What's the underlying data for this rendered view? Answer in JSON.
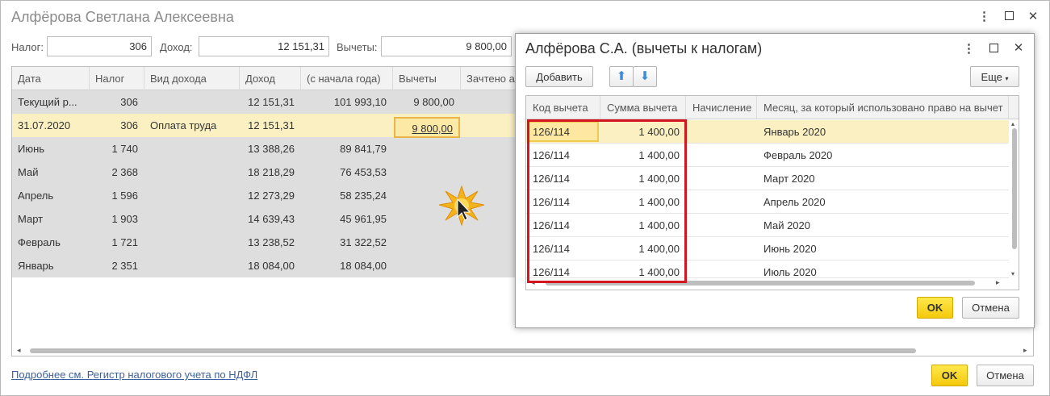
{
  "main": {
    "title": "Алфёрова Светлана Алексеевна",
    "tax_label": "Налог:",
    "tax_value": "306",
    "income_label": "Доход:",
    "income_value": "12 151,31",
    "deductions_label": "Вычеты:",
    "deductions_value": "9 800,00",
    "columns": [
      "Дата",
      "Налог",
      "Вид дохода",
      "Доход",
      "(с начала года)",
      "Вычеты",
      "Зачтено а"
    ],
    "rows": [
      {
        "date": "Текущий р...",
        "tax": "306",
        "type": "",
        "income": "12 151,31",
        "ytd": "101 993,10",
        "deductions": "9 800,00"
      },
      {
        "date": "31.07.2020",
        "tax": "306",
        "type": "Оплата труда",
        "income": "12 151,31",
        "ytd": "",
        "deductions": "9 800,00"
      },
      {
        "date": "Июнь",
        "tax": "1 740",
        "type": "",
        "income": "13 388,26",
        "ytd": "89 841,79",
        "deductions": ""
      },
      {
        "date": "Май",
        "tax": "2 368",
        "type": "",
        "income": "18 218,29",
        "ytd": "76 453,53",
        "deductions": ""
      },
      {
        "date": "Апрель",
        "tax": "1 596",
        "type": "",
        "income": "12 273,29",
        "ytd": "58 235,24",
        "deductions": ""
      },
      {
        "date": "Март",
        "tax": "1 903",
        "type": "",
        "income": "14 639,43",
        "ytd": "45 961,95",
        "deductions": ""
      },
      {
        "date": "Февраль",
        "tax": "1 721",
        "type": "",
        "income": "13 238,52",
        "ytd": "31 322,52",
        "deductions": ""
      },
      {
        "date": "Январь",
        "tax": "2 351",
        "type": "",
        "income": "18 084,00",
        "ytd": "18 084,00",
        "deductions": ""
      }
    ],
    "link": "Подробнее см. Регистр налогового учета по НДФЛ",
    "ok": "OK",
    "cancel": "Отмена"
  },
  "dialog": {
    "title": "Алфёрова С.А. (вычеты к налогам)",
    "add": "Добавить",
    "more": "Еще",
    "columns": [
      "Код вычета",
      "Сумма вычета",
      "Начисление",
      "Месяц, за который использовано право на вычет"
    ],
    "rows": [
      {
        "code": "126/114",
        "amount": "1 400,00",
        "accrual": "",
        "month": "Январь 2020"
      },
      {
        "code": "126/114",
        "amount": "1 400,00",
        "accrual": "",
        "month": "Февраль 2020"
      },
      {
        "code": "126/114",
        "amount": "1 400,00",
        "accrual": "",
        "month": "Март 2020"
      },
      {
        "code": "126/114",
        "amount": "1 400,00",
        "accrual": "",
        "month": "Апрель 2020"
      },
      {
        "code": "126/114",
        "amount": "1 400,00",
        "accrual": "",
        "month": "Май 2020"
      },
      {
        "code": "126/114",
        "amount": "1 400,00",
        "accrual": "",
        "month": "Июнь 2020"
      },
      {
        "code": "126/114",
        "amount": "1 400,00",
        "accrual": "",
        "month": "Июль 2020"
      }
    ],
    "ok": "OK",
    "cancel": "Отмена"
  },
  "colors": {
    "accent_yellow": "#f4c90c",
    "selection": "#fbf0c2",
    "highlight_red": "#d4151f",
    "link_blue": "#3c5f9c"
  }
}
